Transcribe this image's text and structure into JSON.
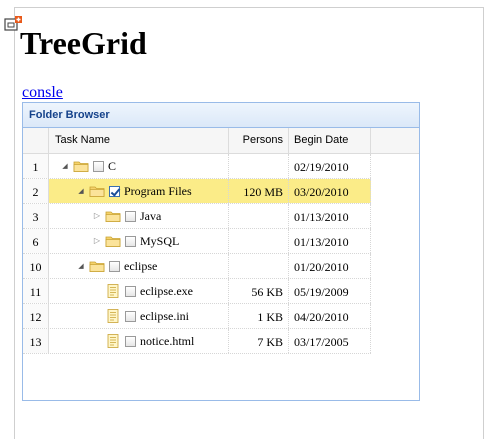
{
  "page": {
    "title": "TreeGrid",
    "console_link": "consle"
  },
  "panel": {
    "title": "Folder Browser"
  },
  "columns": {
    "name": "Task Name",
    "persons": "Persons",
    "date": "Begin Date"
  },
  "rows": [
    {
      "num": "1",
      "name": "C",
      "persons": "",
      "date": "02/19/2010",
      "type": "folder",
      "level": 0,
      "expander": "expanded",
      "checked": false,
      "selected": false
    },
    {
      "num": "2",
      "name": "Program Files",
      "persons": "120 MB",
      "date": "03/20/2010",
      "type": "folder",
      "level": 1,
      "expander": "expanded",
      "checked": true,
      "selected": true
    },
    {
      "num": "3",
      "name": "Java",
      "persons": "",
      "date": "01/13/2010",
      "type": "folder",
      "level": 2,
      "expander": "collapsed",
      "checked": false,
      "selected": false
    },
    {
      "num": "6",
      "name": "MySQL",
      "persons": "",
      "date": "01/13/2010",
      "type": "folder",
      "level": 2,
      "expander": "collapsed",
      "checked": false,
      "selected": false
    },
    {
      "num": "10",
      "name": "eclipse",
      "persons": "",
      "date": "01/20/2010",
      "type": "folder",
      "level": 1,
      "expander": "expanded",
      "checked": false,
      "selected": false
    },
    {
      "num": "11",
      "name": "eclipse.exe",
      "persons": "56 KB",
      "date": "05/19/2009",
      "type": "file",
      "level": 2,
      "expander": "none",
      "checked": false,
      "selected": false
    },
    {
      "num": "12",
      "name": "eclipse.ini",
      "persons": "1 KB",
      "date": "04/20/2010",
      "type": "file",
      "level": 2,
      "expander": "none",
      "checked": false,
      "selected": false
    },
    {
      "num": "13",
      "name": "notice.html",
      "persons": "7 KB",
      "date": "03/17/2005",
      "type": "file",
      "level": 2,
      "expander": "none",
      "checked": false,
      "selected": false
    }
  ],
  "colors": {
    "selected_row": "#fbec88",
    "panel_border": "#99bbe8",
    "panel_title": "#15428b",
    "folder": "#f5d26a"
  }
}
